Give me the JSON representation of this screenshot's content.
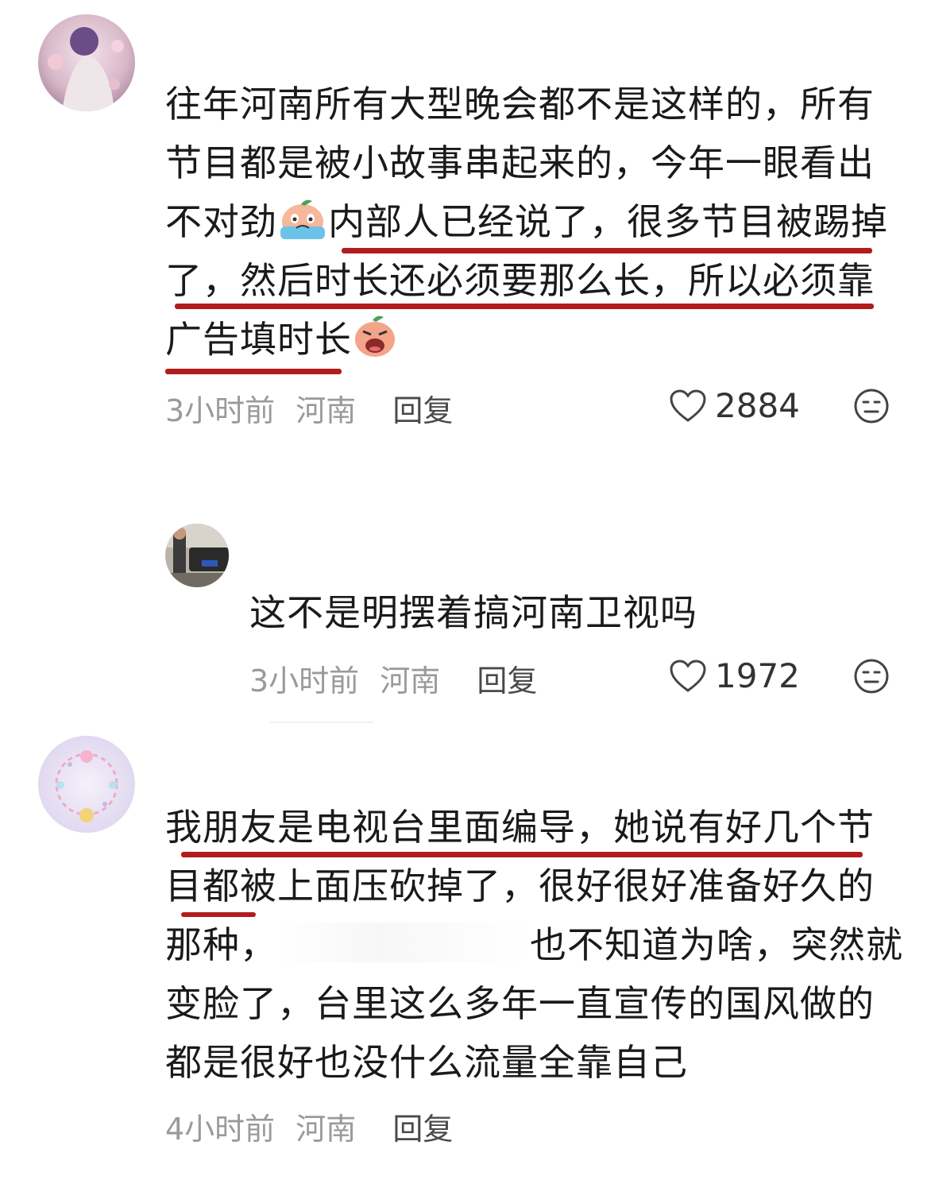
{
  "comments": [
    {
      "lines": [
        "往年河南所有大型晚会都不是这样的，所有",
        "节目都是被小故事串起来的，今年一眼看出",
        "不对劲",
        "内部人已经说了，很多节目被踢掉",
        "了，然后时长还必须要那么长，所以必须靠",
        "广告填时长"
      ],
      "time": "3小时前",
      "location": "河南",
      "reply": "回复",
      "likes": "2884"
    },
    {
      "lines": [
        "这不是明摆着搞河南卫视吗"
      ],
      "time": "3小时前",
      "location": "河南",
      "reply": "回复",
      "likes": "1972"
    },
    {
      "lines": [
        "我朋友是电视台里面编导，她说有好几个节",
        "目都被上面压砍掉了，很好很好准备好久的",
        "那种，",
        "也不知道为啥，突然就",
        "变脸了，台里这么多年一直宣传的国风做的",
        "都是很好也没什么流量全靠自己"
      ],
      "time": "4小时前",
      "location": "河南",
      "reply": "回复"
    }
  ],
  "icons": {
    "like": "heart-outline-icon",
    "dislike": "neutral-face-icon",
    "emoji_cry": "crying-peach-emoji",
    "emoji_scream": "wailing-peach-emoji"
  },
  "colors": {
    "underline": "#b21c1c",
    "meta_text": "#9a9a9a"
  }
}
